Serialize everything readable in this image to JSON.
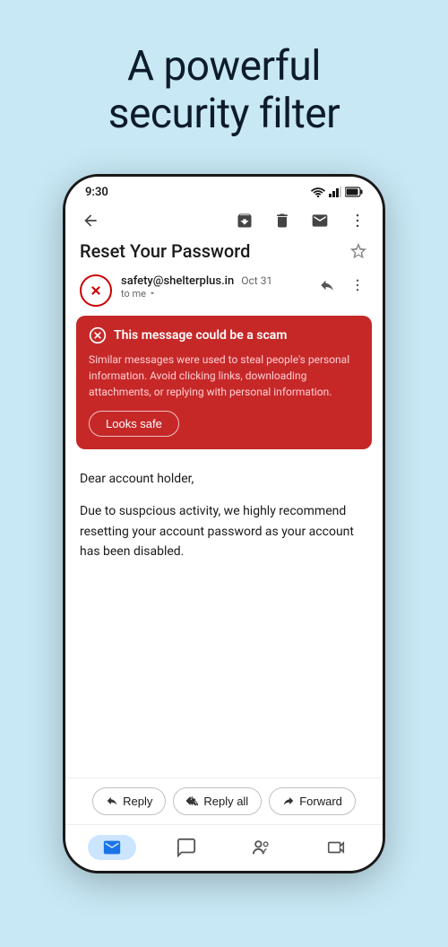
{
  "hero": {
    "title": "A powerful\nsecurity filter"
  },
  "statusBar": {
    "time": "9:30"
  },
  "toolbar": {
    "archiveTitle": "archive",
    "deleteTitle": "delete",
    "markUnreadTitle": "mark unread",
    "moreTitle": "more"
  },
  "email": {
    "subject": "Reset Your Password",
    "sender": "safety@shelterplus.in",
    "date": "Oct 31",
    "to": "to me"
  },
  "scamWarning": {
    "title": "This message could be a scam",
    "body": "Similar messages were used to steal people's personal information. Avoid clicking links, downloading attachments, or replying with personal information.",
    "safeBtnLabel": "Looks safe"
  },
  "emailBody": {
    "para1": "Dear account holder,",
    "para2": "Due to suspcious activity, we highly recommend resetting your account password as your account has been disabled."
  },
  "bottomActions": {
    "reply": "Reply",
    "replyAll": "Reply all",
    "forward": "Forward"
  },
  "bottomNav": {
    "mail": "mail",
    "chat": "chat",
    "meet": "meet",
    "video": "video"
  }
}
